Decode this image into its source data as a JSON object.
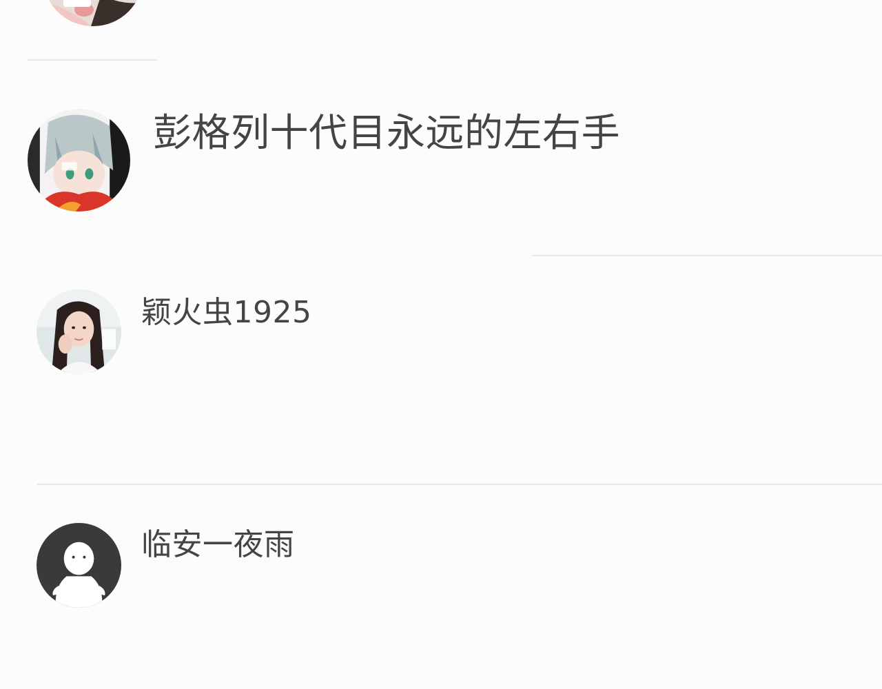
{
  "users": [
    {
      "name": "",
      "avatar": "partial-avatar-icon"
    },
    {
      "name": "彭格列十代目永远的左右手",
      "avatar": "anime-avatar-icon"
    },
    {
      "name": "颖火虫1925",
      "avatar": "photo-avatar-icon"
    },
    {
      "name": "临安一夜雨",
      "avatar": "default-avatar-icon"
    }
  ],
  "colors": {
    "background": "#fdfcfd",
    "divider": "#e9e7e9",
    "text": "#444444",
    "default_avatar": "#3a3a3a"
  }
}
